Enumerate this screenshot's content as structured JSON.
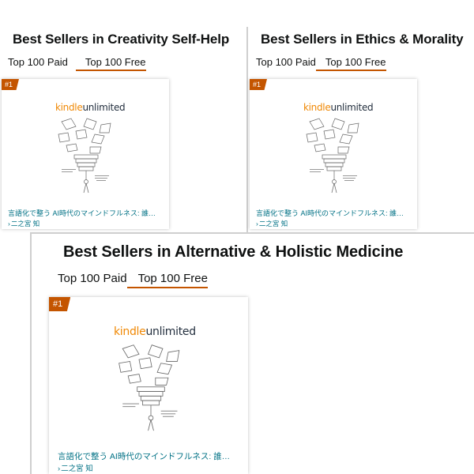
{
  "panels": [
    {
      "title": "Best Sellers in Creativity Self-Help",
      "tabs": [
        "Top 100 Paid",
        "Top 100 Free"
      ],
      "rank": "#1",
      "logo": {
        "k": "kindle",
        "u": "unlimited"
      },
      "book_title": "言語化で整う AI時代のマインドフルネス: 誰…",
      "author": "二之宮 知"
    },
    {
      "title": "Best Sellers in Ethics & Morality",
      "tabs": [
        "Top 100 Paid",
        "Top 100 Free"
      ],
      "rank": "#1",
      "logo": {
        "k": "kindle",
        "u": "unlimited"
      },
      "book_title": "言語化で整う AI時代のマインドフルネス: 誰…",
      "author": "二之宮 知"
    },
    {
      "title": "Best Sellers in Alternative & Holistic Medicine",
      "tabs": [
        "Top 100 Paid",
        "Top 100 Free"
      ],
      "rank": "#1",
      "logo": {
        "k": "kindle",
        "u": "unlimited"
      },
      "book_title": "言語化で整う AI時代のマインドフルネス: 誰…",
      "author": "二之宮 知"
    }
  ],
  "active_tab": "Top 100 Free",
  "colors": {
    "accent": "#c45500",
    "link": "#007185",
    "kindle": "#f08804"
  },
  "icons": [
    "chevron-right-icon"
  ]
}
